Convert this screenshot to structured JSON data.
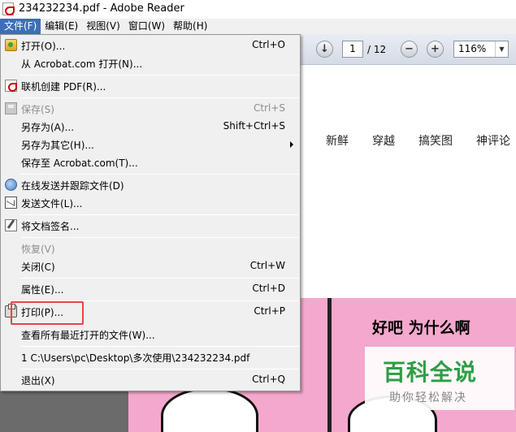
{
  "window": {
    "title": "234232234.pdf - Adobe Reader"
  },
  "menubar": {
    "items": [
      {
        "label": "文件(F)"
      },
      {
        "label": "编辑(E)"
      },
      {
        "label": "视图(V)"
      },
      {
        "label": "窗口(W)"
      },
      {
        "label": "帮助(H)"
      }
    ]
  },
  "toolbar": {
    "current_page": "1",
    "total_pages": "/ 12",
    "zoom": "116%"
  },
  "file_menu": {
    "items": [
      {
        "label": "打开(O)...",
        "shortcut": "Ctrl+O",
        "icon": "open-icon"
      },
      {
        "label": "从 Acrobat.com 打开(N)...",
        "shortcut": ""
      },
      {
        "label": "联机创建 PDF(R)...",
        "shortcut": "",
        "icon": "pdf-icon"
      },
      {
        "label": "保存(S)",
        "shortcut": "Ctrl+S",
        "icon": "save-icon",
        "disabled": true
      },
      {
        "label": "另存为(A)...",
        "shortcut": "Shift+Ctrl+S"
      },
      {
        "label": "另存为其它(H)...",
        "shortcut": "",
        "submenu": true
      },
      {
        "label": "保存至 Acrobat.com(T)...",
        "shortcut": ""
      },
      {
        "label": "在线发送并跟踪文件(D)",
        "shortcut": "",
        "icon": "track-icon"
      },
      {
        "label": "发送文件(L)...",
        "shortcut": "",
        "icon": "send-icon"
      },
      {
        "label": "将文档签名...",
        "shortcut": "",
        "icon": "sign-icon"
      },
      {
        "label": "恢复(V)",
        "shortcut": "",
        "disabled": true
      },
      {
        "label": "关闭(C)",
        "shortcut": "Ctrl+W"
      },
      {
        "label": "属性(E)...",
        "shortcut": "Ctrl+D"
      },
      {
        "label": "打印(P)...",
        "shortcut": "Ctrl+P",
        "icon": "print-icon"
      },
      {
        "label": "查看所有最近打开的文件(W)...",
        "shortcut": ""
      },
      {
        "label": "1 C:\\Users\\pc\\Desktop\\多次使用\\234232234.pdf",
        "shortcut": ""
      },
      {
        "label": "退出(X)",
        "shortcut": "Ctrl+Q"
      }
    ]
  },
  "document": {
    "nav_links": [
      "新鲜",
      "穿越",
      "搞笑图",
      "神评论"
    ],
    "comic_text": "好吧 为什么啊"
  },
  "watermark": {
    "title": "百科全说",
    "subtitle": "助你轻松解决"
  },
  "colors": {
    "menu_active": "#3d6fb8",
    "highlight_box": "#e8434b",
    "comic_pink": "#f4a8cd",
    "watermark_green": "#2e9e45"
  }
}
